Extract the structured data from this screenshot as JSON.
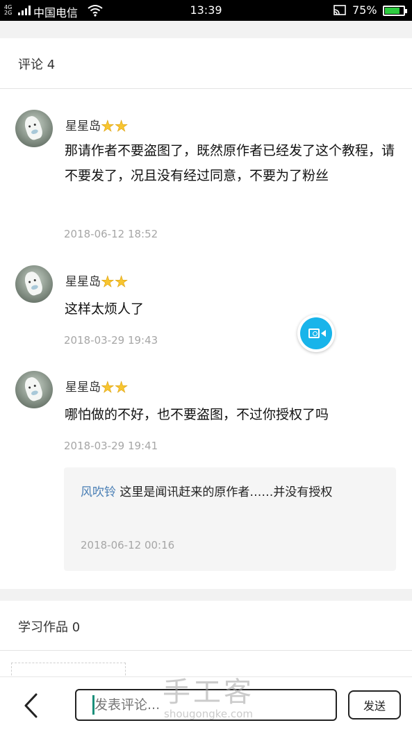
{
  "status_bar": {
    "network": "4G\n2G",
    "carrier": "中国电信",
    "time": "13:39",
    "battery": "75%",
    "battery_level_percent": 75
  },
  "comments_section": {
    "title": "评论 4",
    "items": [
      {
        "username": "星星岛",
        "badge_stars": 2,
        "content": "那请作者不要盗图了，既然原作者已经发了这个教程，请不要发了，况且没有经过同意，不要为了粉丝",
        "timestamp": "2018-06-12 18:52"
      },
      {
        "username": "星星岛",
        "badge_stars": 2,
        "content": "这样太烦人了",
        "timestamp": "2018-03-29 19:43"
      },
      {
        "username": "星星岛",
        "badge_stars": 2,
        "content": "哪怕做的不好，也不要盗图，不过你授权了吗",
        "timestamp": "2018-03-29 19:41",
        "reply": {
          "user": "风吹铃",
          "text": " 这里是闻讯赶来的原作者……并没有授权",
          "timestamp": "2018-06-12 00:16"
        }
      }
    ]
  },
  "works_section": {
    "title": "学习作品 0"
  },
  "bottom_bar": {
    "input_placeholder": "发表评论...",
    "send_label": "发送"
  },
  "watermark": {
    "cn": "手工客",
    "en": "shougongke.com"
  },
  "icons": {
    "video_button": "video-camera-icon",
    "back": "chevron-left-icon",
    "star": "star-icon"
  },
  "colors": {
    "reply_user": "#4a7fb5",
    "video_button": "#18b4ea",
    "star": "#f7c531"
  }
}
